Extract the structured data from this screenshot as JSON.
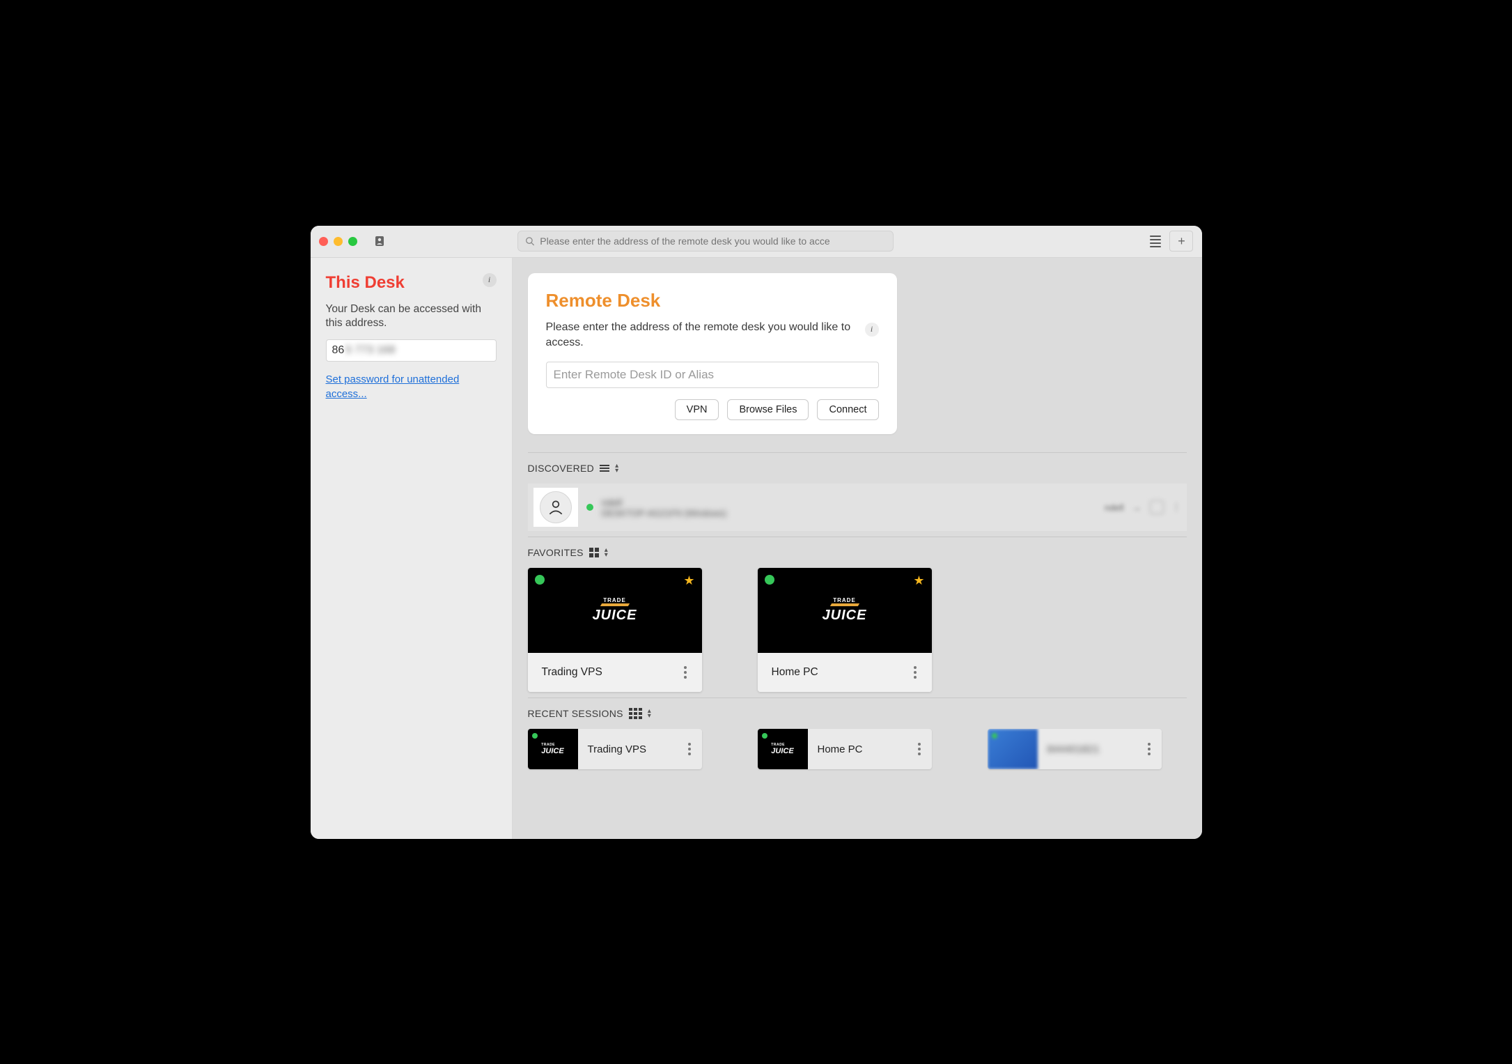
{
  "titlebar": {
    "search_placeholder": "Please enter the address of the remote desk you would like to acce"
  },
  "sidebar": {
    "title": "This Desk",
    "description": "Your Desk can be accessed with this address.",
    "address_prefix": "86",
    "address_hidden": "5 773 168",
    "set_password_link": "Set password for unattended access..."
  },
  "remote_card": {
    "title": "Remote Desk",
    "description": "Please enter the address of the remote desk you would like to access.",
    "input_placeholder": "Enter Remote Desk ID or Alias",
    "btn_vpn": "VPN",
    "btn_browse": "Browse Files",
    "btn_connect": "Connect"
  },
  "sections": {
    "discovered": "DISCOVERED",
    "favorites": "FAVORITES",
    "recent": "RECENT SESSIONS"
  },
  "discovered": {
    "name_line1": "ndell",
    "name_line2": "DESKTOP-AG21F9 (Windows)",
    "right_label": "ndell"
  },
  "favorites": [
    {
      "name": "Trading VPS"
    },
    {
      "name": "Home PC"
    }
  ],
  "recent": [
    {
      "name": "Trading VPS",
      "thumb": "logo"
    },
    {
      "name": "Home PC",
      "thumb": "logo"
    },
    {
      "name": "844401821",
      "thumb": "blue",
      "blurred": true
    }
  ]
}
